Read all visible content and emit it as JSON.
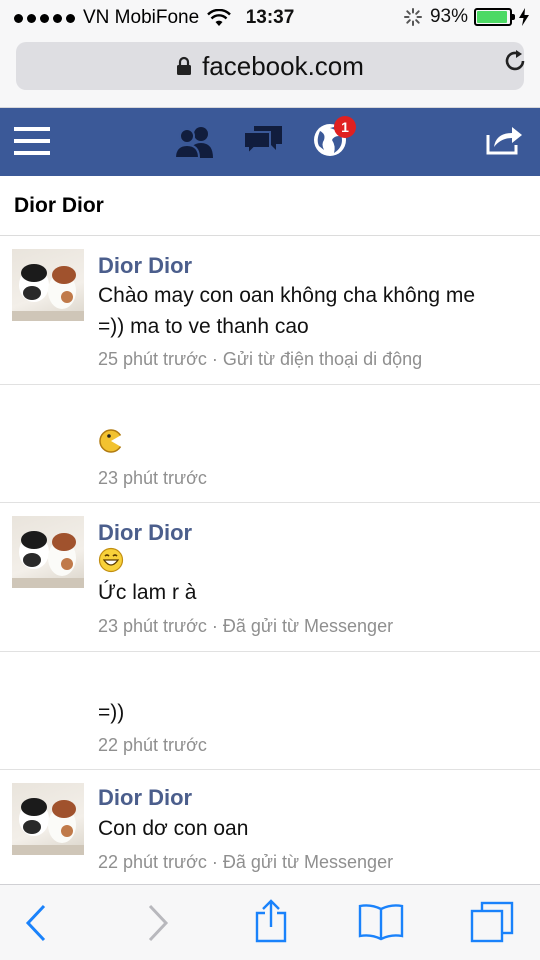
{
  "status_bar": {
    "carrier": "VN MobiFone",
    "time": "13:37",
    "battery_percent": "93%",
    "battery_level": 0.93
  },
  "browser": {
    "url": "facebook.com"
  },
  "fb_nav": {
    "notification_count": "1"
  },
  "page": {
    "title": "Dior Dior"
  },
  "messages": [
    {
      "sender": "Dior Dior",
      "lines": [
        "Chào may con oan không cha không me",
        "=)) ma to ve thanh cao"
      ],
      "time": "25 phút trước",
      "via": " · Gửi từ điện thoại di động"
    },
    {
      "sender": "",
      "emoji": "pacman-emoticon",
      "lines": [],
      "time": "23 phút trước",
      "via": ""
    },
    {
      "sender": "Dior Dior",
      "emoji": "smile-emoticon",
      "lines": [
        "Ức lam r à"
      ],
      "time": "23 phút trước",
      "via": " · Đã gửi từ Messenger"
    },
    {
      "sender": "",
      "lines": [
        "=))"
      ],
      "time": "22 phút trước",
      "via": ""
    },
    {
      "sender": "Dior Dior",
      "lines": [
        "Con dơ con oan"
      ],
      "time": "22 phút trước",
      "via": " · Đã gửi từ Messenger"
    }
  ],
  "toolbar": {
    "icons": [
      "back-icon",
      "forward-icon",
      "share-icon",
      "bookmarks-icon",
      "tabs-icon"
    ]
  },
  "colors": {
    "fb_blue": "#3b5998",
    "sender_blue": "#4b5e8c",
    "ios_blue": "#1a82fb",
    "battery_green": "#4cd964",
    "badge_red": "#e02020"
  }
}
